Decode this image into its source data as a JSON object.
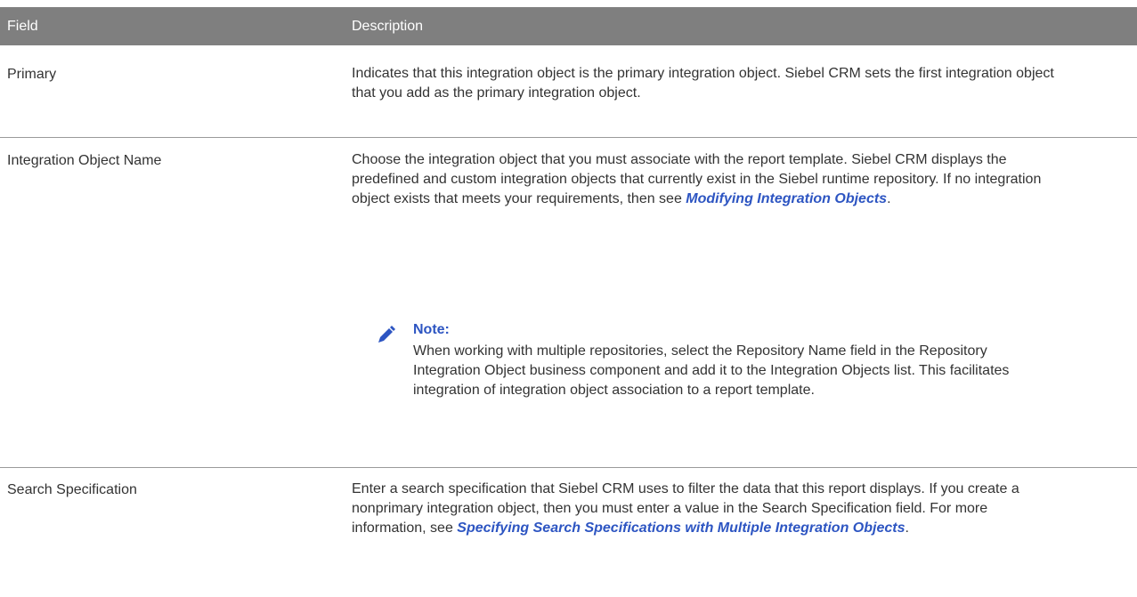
{
  "header": {
    "field": "Field",
    "description": "Description"
  },
  "rows": [
    {
      "field": "Primary",
      "description": "Indicates that this integration object is the primary integration object. Siebel CRM sets the first integration object that you add as the primary integration object."
    },
    {
      "field": "Integration Object Name",
      "description_pre": "Choose the integration object that you must associate with the report template. Siebel CRM displays the predefined and custom integration objects that currently exist in the Siebel runtime repository. If no integration object exists that meets your requirements, then see ",
      "link": "Modifying Integration Objects",
      "description_post": ".",
      "note": {
        "title": "Note:",
        "body": "When working with multiple repositories, select the Repository Name field in the Repository Integration Object business component and add it to the Integration Objects list. This facilitates integration of integration object association to a report template."
      }
    },
    {
      "field": "Search Specification",
      "description_pre": "Enter a search specification that Siebel CRM uses to filter the data that this report displays. If you create a nonprimary integration object, then you must enter a value in the Search Specification field. For more information, see ",
      "link": "Specifying Search Specifications with Multiple Integration Objects",
      "description_post": "."
    }
  ],
  "colors": {
    "header_bg": "#7f7f7f",
    "link": "#2d55c2",
    "text": "#333333"
  },
  "icons": {
    "note": "pencil-icon"
  }
}
